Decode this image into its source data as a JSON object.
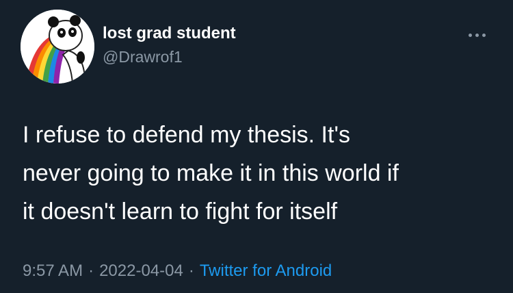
{
  "author": {
    "display_name": "lost grad student",
    "handle": "@Drawrof1",
    "avatar_icon": "panda-rainbow-avatar-icon"
  },
  "more_icon": "more-horizontal-icon",
  "tweet": {
    "lines": [
      "I refuse to defend my thesis. It's",
      "never going to make it in this world if",
      "it doesn't learn to fight for itself"
    ]
  },
  "meta": {
    "time": "9:57 AM",
    "date": "2022-04-04",
    "separator": "·",
    "source": "Twitter for Android"
  },
  "colors": {
    "background": "#15202b",
    "text": "#ffffff",
    "secondary": "#8b98a5",
    "link": "#1d9bf0"
  }
}
